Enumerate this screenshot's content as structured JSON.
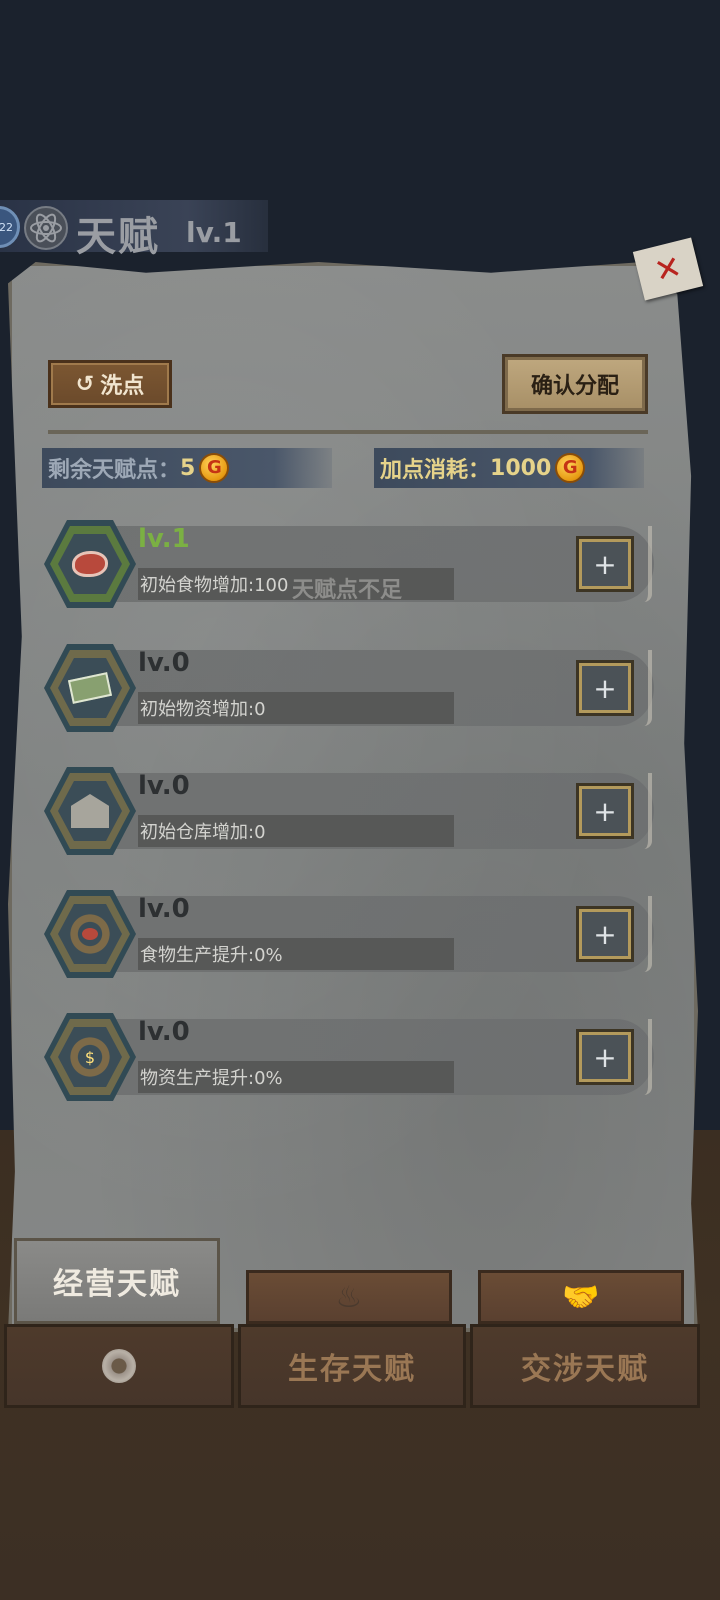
{
  "header": {
    "badge_text": "22",
    "title": "天赋",
    "level": "lv.1"
  },
  "toolbar": {
    "reset_icon": "↺",
    "reset_label": "洗点",
    "confirm_label": "确认分配"
  },
  "stats": {
    "remaining_label": "剩余天赋点：",
    "remaining_value": "5",
    "cost_label": "加点消耗：",
    "cost_value": "1000",
    "coin_symbol": "G"
  },
  "toast": "天赋点不足",
  "talents": [
    {
      "icon": "steak-icon",
      "level": "lv.1",
      "desc": "初始食物增加:100",
      "plus": "+"
    },
    {
      "icon": "cash-icon",
      "level": "lv.0",
      "desc": "初始物资增加:0",
      "plus": "+"
    },
    {
      "icon": "warehouse-icon",
      "level": "lv.0",
      "desc": "初始仓库增加:0",
      "plus": "+"
    },
    {
      "icon": "food-gear-icon",
      "level": "lv.0",
      "desc": "食物生产提升:0%",
      "plus": "+"
    },
    {
      "icon": "money-gear-icon",
      "level": "lv.0",
      "desc": "物资生产提升:0%",
      "plus": "+"
    }
  ],
  "tabs": {
    "active": "经营天赋",
    "survival": "生存天赋",
    "negotiation": "交涉天赋"
  },
  "colors": {
    "level_active": "#7bb043",
    "coin": "#e79a12"
  }
}
